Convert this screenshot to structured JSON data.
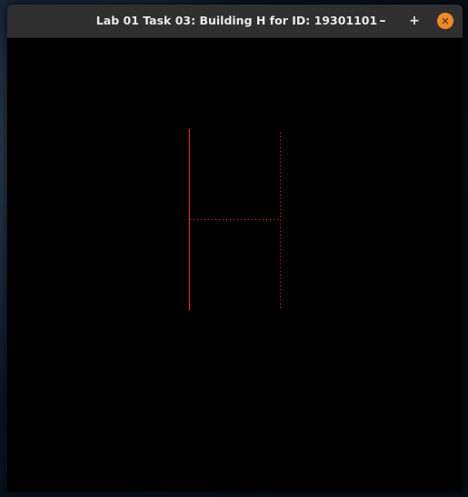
{
  "window": {
    "title": "Lab 01 Task 03: Building H for ID: 19301101",
    "buttons": {
      "minimize_glyph": "–",
      "maximize_glyph": "+",
      "close_glyph": "✕"
    },
    "accent_close": "#f08a24",
    "titlebar_color": "#2f2f2f"
  },
  "canvas": {
    "background": "#000000",
    "stroke_color": "#ff2020",
    "shape": "letter-H",
    "strokes": [
      {
        "id": "left-vertical",
        "style": "solid"
      },
      {
        "id": "right-vertical",
        "style": "dotted"
      },
      {
        "id": "crossbar",
        "style": "dotted"
      }
    ]
  }
}
